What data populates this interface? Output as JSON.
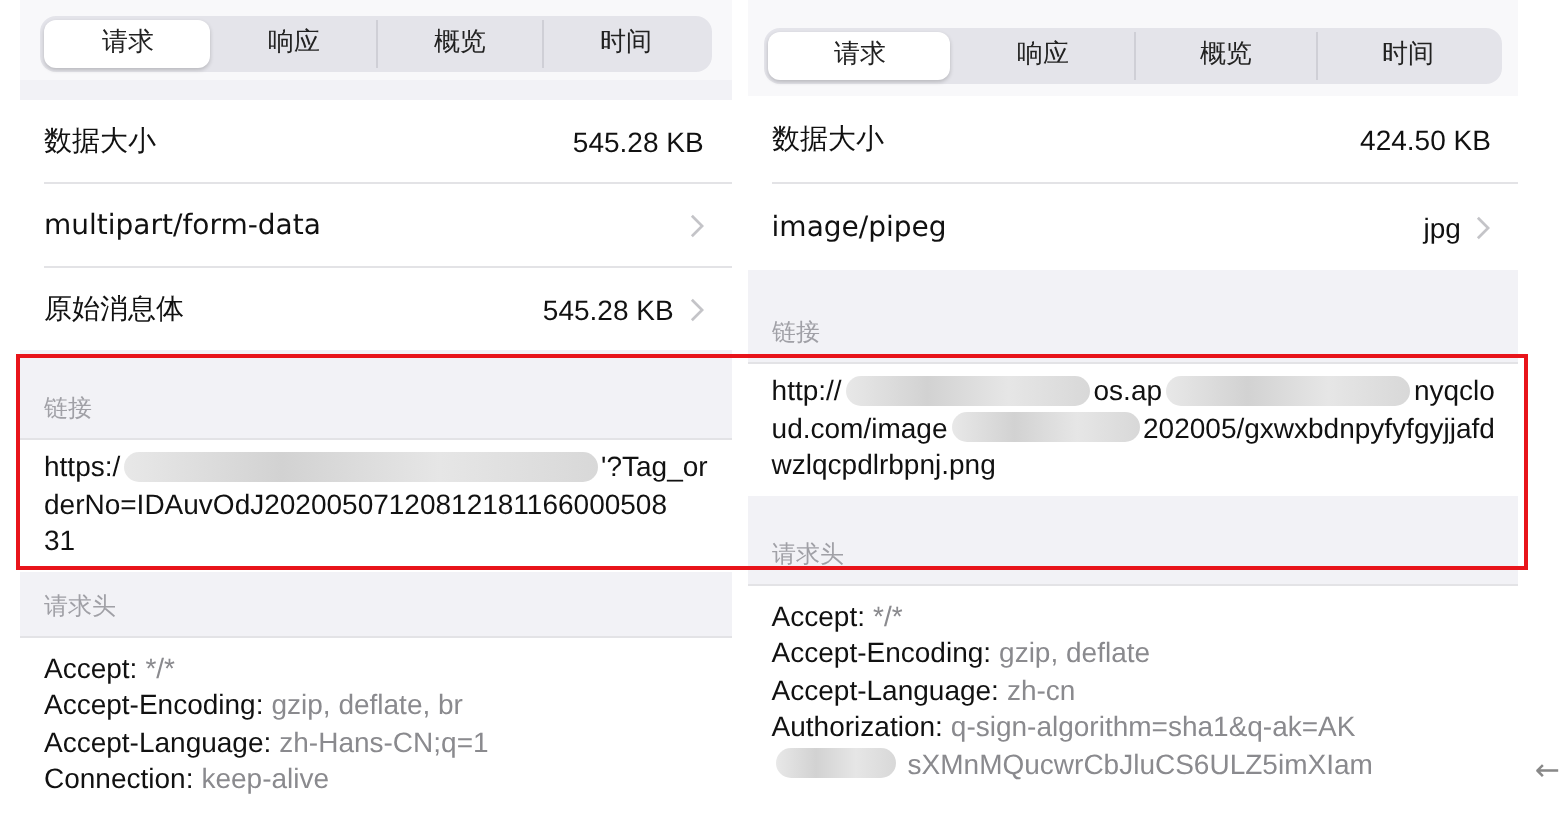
{
  "panels": [
    {
      "tabs": [
        {
          "label": "请求",
          "selected": true
        },
        {
          "label": "响应",
          "selected": false
        },
        {
          "label": "概览",
          "selected": false
        },
        {
          "label": "时间",
          "selected": false
        }
      ],
      "rows": [
        {
          "label": "数据大小",
          "value": "545.28 KB",
          "chevron": false
        },
        {
          "label": "multipart/form-data",
          "chevron": true
        },
        {
          "label": "原始消息体",
          "value": "545.28 KB",
          "chevron": true
        }
      ],
      "link_header": "链接",
      "link_lines": [
        [
          {
            "kind": "text",
            "text": "https:/"
          },
          {
            "kind": "redacted"
          },
          {
            "kind": "text",
            "text": "'?Tag_or"
          }
        ],
        [
          {
            "kind": "text",
            "text": "derNo=IDAuvOdJ20200507120812181166000508"
          }
        ],
        [
          {
            "kind": "text",
            "text": "31"
          }
        ]
      ],
      "headers_header": "请求头",
      "headers": [
        {
          "kind": "field",
          "name": "Accept:",
          "value": "*/*"
        },
        {
          "kind": "field",
          "name": "Accept-Encoding:",
          "value": "gzip, deflate, br"
        },
        {
          "kind": "field",
          "name": "Accept-Language:",
          "value": "zh-Hans-CN;q=1"
        },
        {
          "kind": "field",
          "name": "Connection:",
          "value": "keep-alive"
        }
      ]
    },
    {
      "tabs": [
        {
          "label": "请求",
          "selected": true
        },
        {
          "label": "响应",
          "selected": false
        },
        {
          "label": "概览",
          "selected": false
        },
        {
          "label": "时间",
          "selected": false
        }
      ],
      "rows": [
        {
          "label": "数据大小",
          "value": "424.50 KB",
          "chevron": false
        },
        {
          "label": "image/pipeg",
          "value": "jpg",
          "chevron": true
        }
      ],
      "link_header": "链接",
      "link_lines": [
        [
          {
            "kind": "text",
            "text": "http://"
          },
          {
            "kind": "redacted"
          },
          {
            "kind": "text",
            "text": "os.ap"
          },
          {
            "kind": "redacted"
          },
          {
            "kind": "text",
            "text": "nyqclo"
          }
        ],
        [
          {
            "kind": "text",
            "text": "ud.com/image"
          },
          {
            "kind": "redacted"
          },
          {
            "kind": "text",
            "text": "202005/gxwxbdnpyfyfgyjjafd"
          }
        ],
        [
          {
            "kind": "text",
            "text": "wzlqcpdlrbpnj.png"
          }
        ]
      ],
      "headers_header": "请求头",
      "headers": [
        {
          "kind": "field",
          "name": "Accept:",
          "value": "*/*"
        },
        {
          "kind": "field",
          "name": "Accept-Encoding:",
          "value": "gzip, deflate"
        },
        {
          "kind": "field",
          "name": "Accept-Language:",
          "value": "zh-cn"
        },
        {
          "kind": "field",
          "name": "Authorization:",
          "value": "q-sign-algorithm=sha1&q-ak=AK"
        },
        {
          "kind": "continuation",
          "parts": [
            {
              "kind": "redacted"
            },
            {
              "kind": "text",
              "text": "sXMnMQucwrCbJluCS6ULZ5imXIam"
            }
          ]
        }
      ]
    }
  ],
  "back_arrow": "←"
}
